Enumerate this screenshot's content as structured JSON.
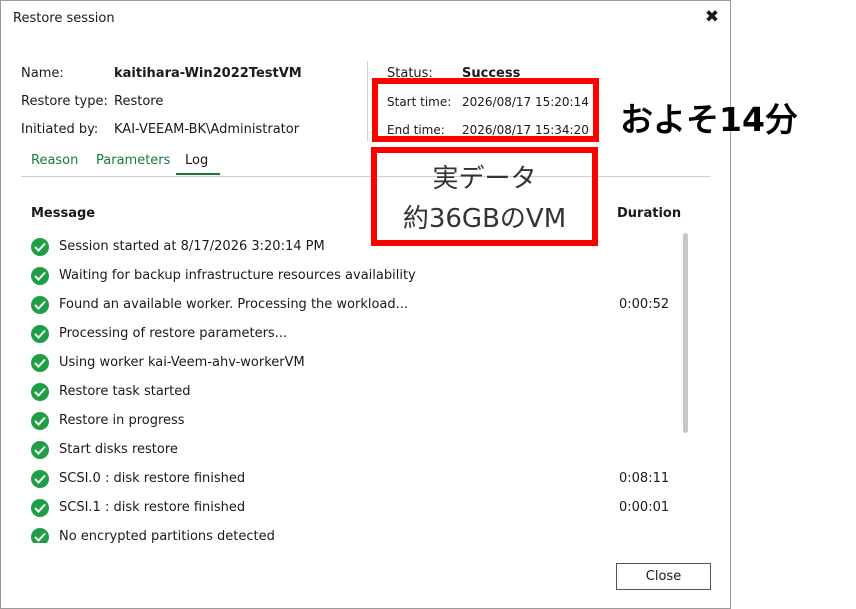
{
  "window": {
    "title": "Restore session",
    "close_glyph": "✖"
  },
  "info": {
    "name_label": "Name:",
    "name_value": "kaitihara-Win2022TestVM",
    "restore_type_label": "Restore type:",
    "restore_type_value": "Restore",
    "initiated_label": "Initiated by:",
    "initiated_value": "KAI-VEEAM-BK\\Administrator",
    "status_label": "Status:",
    "status_value": "Success",
    "start_label": "Start time:",
    "start_value": "2026/08/17 15:20:14",
    "end_label": "End time:",
    "end_value": "2026/08/17 15:34:20"
  },
  "tabs": [
    {
      "label": "Reason"
    },
    {
      "label": "Parameters"
    },
    {
      "label": "Log"
    }
  ],
  "log": {
    "columns": {
      "message": "Message",
      "duration": "Duration"
    },
    "rows": [
      {
        "message": "Session started at 8/17/2026 3:20:14 PM",
        "duration": ""
      },
      {
        "message": "Waiting for backup infrastructure resources availability",
        "duration": ""
      },
      {
        "message": "Found an available worker. Processing the workload...",
        "duration": "0:00:52"
      },
      {
        "message": "Processing of restore parameters...",
        "duration": ""
      },
      {
        "message": "Using worker kai-Veem-ahv-workerVM",
        "duration": ""
      },
      {
        "message": "Restore task started",
        "duration": ""
      },
      {
        "message": "Restore in progress",
        "duration": ""
      },
      {
        "message": "Start disks restore",
        "duration": ""
      },
      {
        "message": "SCSI.0 : disk restore finished",
        "duration": "0:08:11"
      },
      {
        "message": "SCSI.1 : disk restore finished",
        "duration": "0:00:01"
      },
      {
        "message": "No encrypted partitions detected",
        "duration": ""
      }
    ]
  },
  "buttons": {
    "close_label": "Close"
  },
  "annotations": {
    "data_line1": "実データ",
    "data_line2": "約36GBのVM",
    "elapsed": "およそ14分",
    "highlight_color": "#ff0000"
  }
}
